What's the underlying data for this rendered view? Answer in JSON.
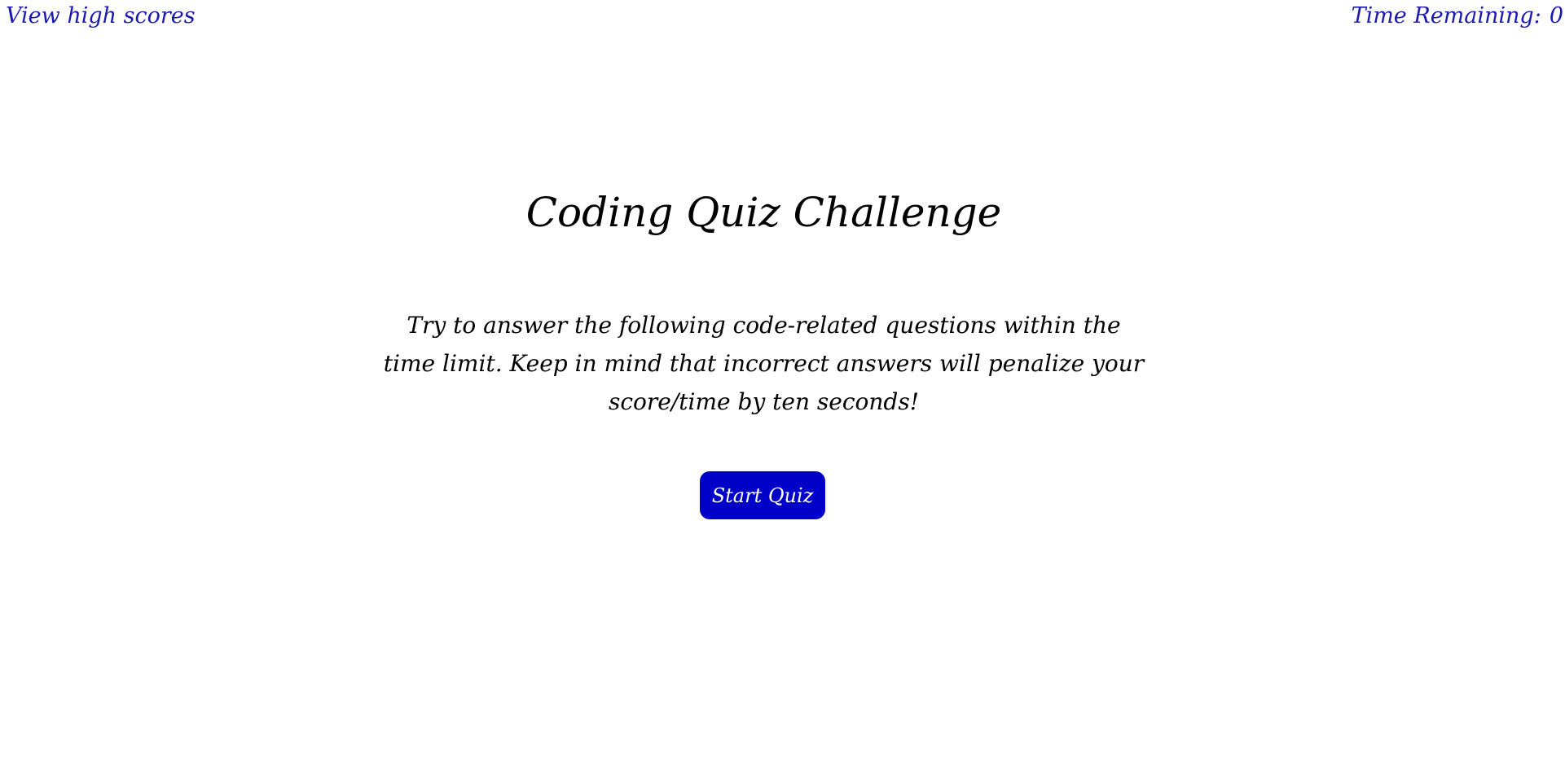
{
  "header": {
    "high_scores_link": "View high scores",
    "timer_label": "Time Remaining:",
    "timer_value": "0"
  },
  "main": {
    "title": "Coding Quiz Challenge",
    "intro": "Try to answer the following code-related questions within the time limit. Keep in mind that incorrect answers will penalize your score/time by ten seconds!",
    "start_button": "Start Quiz"
  },
  "colors": {
    "accent": "#0000c8",
    "link": "#1a1ab0",
    "text": "#000000",
    "background": "#ffffff"
  }
}
